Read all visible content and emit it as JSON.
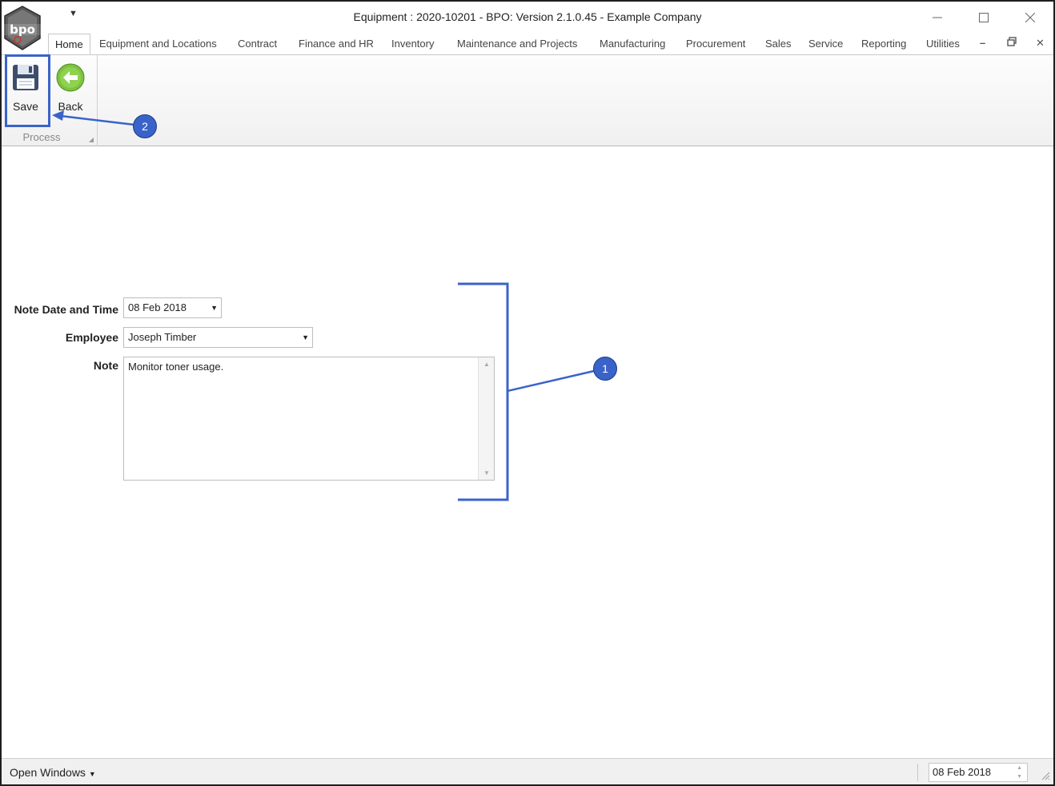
{
  "window": {
    "title": "Equipment : 2020-10201 - BPO: Version 2.1.0.45 - Example Company",
    "logo_text": "bpo",
    "controls": [
      "minimize-icon",
      "maximize-icon",
      "close-icon"
    ]
  },
  "ribbon": {
    "tabs": [
      {
        "label": "Home",
        "active": true
      },
      {
        "label": "Equipment and Locations"
      },
      {
        "label": "Contract"
      },
      {
        "label": "Finance and HR"
      },
      {
        "label": "Inventory"
      },
      {
        "label": "Maintenance and Projects"
      },
      {
        "label": "Manufacturing"
      },
      {
        "label": "Procurement"
      },
      {
        "label": "Sales"
      },
      {
        "label": "Service"
      },
      {
        "label": "Reporting"
      },
      {
        "label": "Utilities"
      }
    ],
    "group": {
      "label": "Process",
      "buttons": [
        {
          "label": "Save",
          "icon": "floppy-disk-icon"
        },
        {
          "label": "Back",
          "icon": "back-arrow-icon"
        }
      ]
    }
  },
  "form": {
    "note_date": {
      "label": "Note Date and Time",
      "value": "08 Feb 2018"
    },
    "employee": {
      "label": "Employee",
      "value": "Joseph Timber"
    },
    "note": {
      "label": "Note",
      "value": "Monitor toner usage."
    }
  },
  "annotations": {
    "callout_1": "1",
    "callout_2": "2",
    "accent_color": "#3a63c9"
  },
  "statusbar": {
    "open_windows": "Open Windows",
    "date": "08 Feb 2018"
  }
}
